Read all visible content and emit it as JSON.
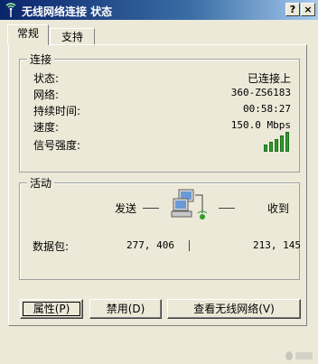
{
  "window": {
    "title": "无线网络连接 状态",
    "help_label": "?",
    "close_label": "×"
  },
  "tabs": [
    {
      "label": "常规"
    },
    {
      "label": "支持"
    }
  ],
  "connection": {
    "group_label": "连接",
    "rows": [
      {
        "label": "状态:",
        "value": "已连接上"
      },
      {
        "label": "网络:",
        "value": "360-ZS6183"
      },
      {
        "label": "持续时间:",
        "value": "00:58:27"
      },
      {
        "label": "速度:",
        "value": "150.0 Mbps"
      }
    ],
    "signal_label": "信号强度:",
    "signal_bars": 5,
    "signal_level_of_5": 5,
    "signal_color": "#2e9d2e"
  },
  "activity": {
    "group_label": "活动",
    "sent_label": "发送",
    "received_label": "收到",
    "packets_label": "数据包:",
    "sent_packets": "277, 406",
    "received_packets": "213, 145"
  },
  "buttons": {
    "properties": "属性(P)",
    "disable": "禁用(D)",
    "view_networks": "查看无线网络(V)"
  },
  "icons": [
    "wireless-signal-icon",
    "network-computers-icon",
    "signal-strength-icon"
  ]
}
